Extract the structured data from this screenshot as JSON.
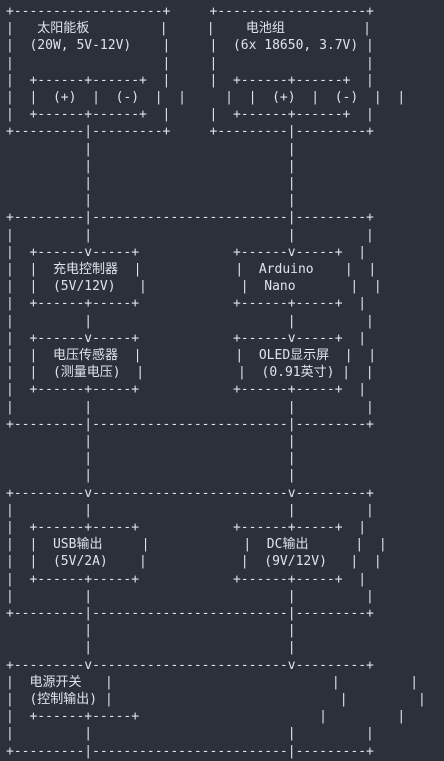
{
  "lines": [
    "+-------------------+     +-------------------+",
    "|   太阳能板         |     |    电池组          |",
    "|  (20W, 5V-12V)    |     |  (6x 18650, 3.7V) |",
    "|                   |     |                   |",
    "|  +------+------+  |     |  +------+------+  |",
    "|  |  (+)  |  (-)  |  |     |  |  (+)  |  (-)  |  |",
    "|  +------+------+  |     |  +------+------+  |",
    "+---------|---------+     +---------|---------+",
    "          |                         |",
    "          |                         |",
    "          |                         |",
    "          |                         |",
    "+---------|-------------------------|---------+",
    "|         |                         |         |",
    "|  +------v-----+            +------v-----+  |",
    "|  |  充电控制器  |            |  Arduino    |  |",
    "|  |  (5V/12V)   |            |  Nano       |  |",
    "|  +------+-----+            +------+-----+  |",
    "|         |                         |         |",
    "|  +------v-----+            +------v-----+  |",
    "|  |  电压传感器  |            |  OLED显示屏  |  |",
    "|  |  (测量电压)  |            |  (0.91英寸) |  |",
    "|  +------+-----+            +------+-----+  |",
    "|         |                         |         |",
    "+---------|-------------------------|---------+",
    "          |                         |",
    "          |                         |",
    "          |                         |",
    "+---------v-------------------------v---------+",
    "|         |                         |         |",
    "|  +------+-----+            +------+-----+  |",
    "|  |  USB输出     |            |  DC输出      |  |",
    "|  |  (5V/2A)    |            |  (9V/12V)   |  |",
    "|  +------+-----+            +------+-----+  |",
    "|         |                         |         |",
    "+---------|-------------------------|---------+",
    "          |                         |",
    "          |                         |",
    "+---------v-------------------------v---------+",
    "|  电源开关   |                            |         |",
    "|  (控制输出) |                             |         |",
    "|  +------+-----+                       |         |",
    "|         |                         |         |",
    "+---------|-------------------------|---------+"
  ]
}
